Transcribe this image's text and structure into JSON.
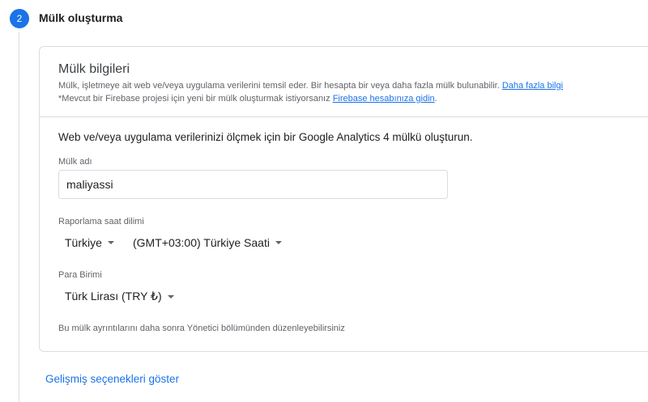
{
  "step": {
    "number": "2",
    "title": "Mülk oluşturma"
  },
  "card": {
    "title": "Mülk bilgileri",
    "desc_line1": "Mülk, işletmeye ait web ve/veya uygulama verilerini temsil eder. Bir hesapta bir veya daha fazla mülk bulunabilir.",
    "learn_more": "Daha fazla bilgi",
    "desc_line2": "*Mevcut bir Firebase projesi için yeni bir mülk oluşturmak istiyorsanız",
    "firebase_link": "Firebase hesabınıza gidin",
    "desc_line2_end": "."
  },
  "form": {
    "intro": "Web ve/veya uygulama verilerinizi ölçmek için bir Google Analytics 4 mülkü oluşturun.",
    "property_name_label": "Mülk adı",
    "property_name_value": "maliyassi",
    "timezone_label": "Raporlama saat dilimi",
    "timezone_country": "Türkiye",
    "timezone_value": "(GMT+03:00) Türkiye Saati",
    "currency_label": "Para Birimi",
    "currency_value": "Türk Lirası (TRY ₺)",
    "footnote": "Bu mülk ayrıntılarını daha sonra Yönetici bölümünden düzenleyebilirsiniz"
  },
  "advanced_link": "Gelişmiş seçenekleri göster",
  "colors": {
    "accent": "#1a73e8",
    "border": "#dadce0",
    "text": "#202124",
    "muted": "#5f6368"
  },
  "icons": {
    "dropdown": "caret-down-icon"
  }
}
